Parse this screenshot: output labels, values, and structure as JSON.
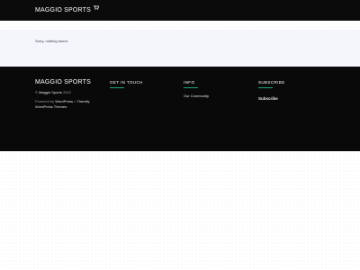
{
  "header": {
    "brand": "MAGGIO SPORTS",
    "cart_icon": "cart-icon"
  },
  "main": {
    "notice": "Sorry, nothing found."
  },
  "footer": {
    "brand": "MAGGIO SPORTS",
    "copyright_prefix": "© ",
    "copyright_brand": "Maggio Sports",
    "copyright_year": " 2020",
    "powered_prefix": "Powered by ",
    "powered_wp": "WordPress",
    "powered_sep": " » ",
    "powered_themify": "Themify",
    "powered_line2": "WordPress Themes",
    "get_in_touch": {
      "title": "GET IN TOUCH",
      "line1": "",
      "line2": "",
      "line3": "",
      "line4": ""
    },
    "info": {
      "title": "INFO",
      "link": "Our Community"
    },
    "subscribe": {
      "title": "SUBSCRIBE",
      "text": "",
      "button": "Subscribe"
    },
    "accent_color": "#1aa37a"
  }
}
